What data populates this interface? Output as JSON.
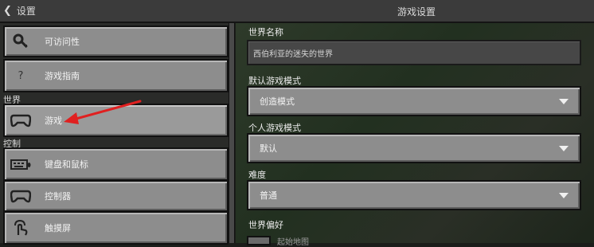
{
  "header": {
    "back_label": "设置",
    "title": "游戏设置"
  },
  "sidebar": {
    "items_top": [
      {
        "label": "可访问性",
        "icon": "key-icon"
      },
      {
        "label": "游戏指南",
        "icon": "question-icon"
      }
    ],
    "section_world": "世界",
    "world_items": [
      {
        "label": "游戏",
        "icon": "gamepad-icon",
        "selected": true
      }
    ],
    "section_controls": "控制",
    "control_items": [
      {
        "label": "键盘和鼠标",
        "icon": "keyboard-icon"
      },
      {
        "label": "控制器",
        "icon": "controller-icon"
      },
      {
        "label": "触摸屏",
        "icon": "touch-icon"
      }
    ]
  },
  "main": {
    "world_name_label": "世界名称",
    "world_name_value": "西伯利亚的迷失的世界",
    "default_mode_label": "默认游戏模式",
    "default_mode_value": "创造模式",
    "personal_mode_label": "个人游戏模式",
    "personal_mode_value": "默认",
    "difficulty_label": "难度",
    "difficulty_value": "普通",
    "world_prefs_label": "世界偏好",
    "partial_option_label": "起始地图"
  },
  "colors": {
    "button": "#8d8d8d",
    "annotation_arrow": "#e02020"
  }
}
